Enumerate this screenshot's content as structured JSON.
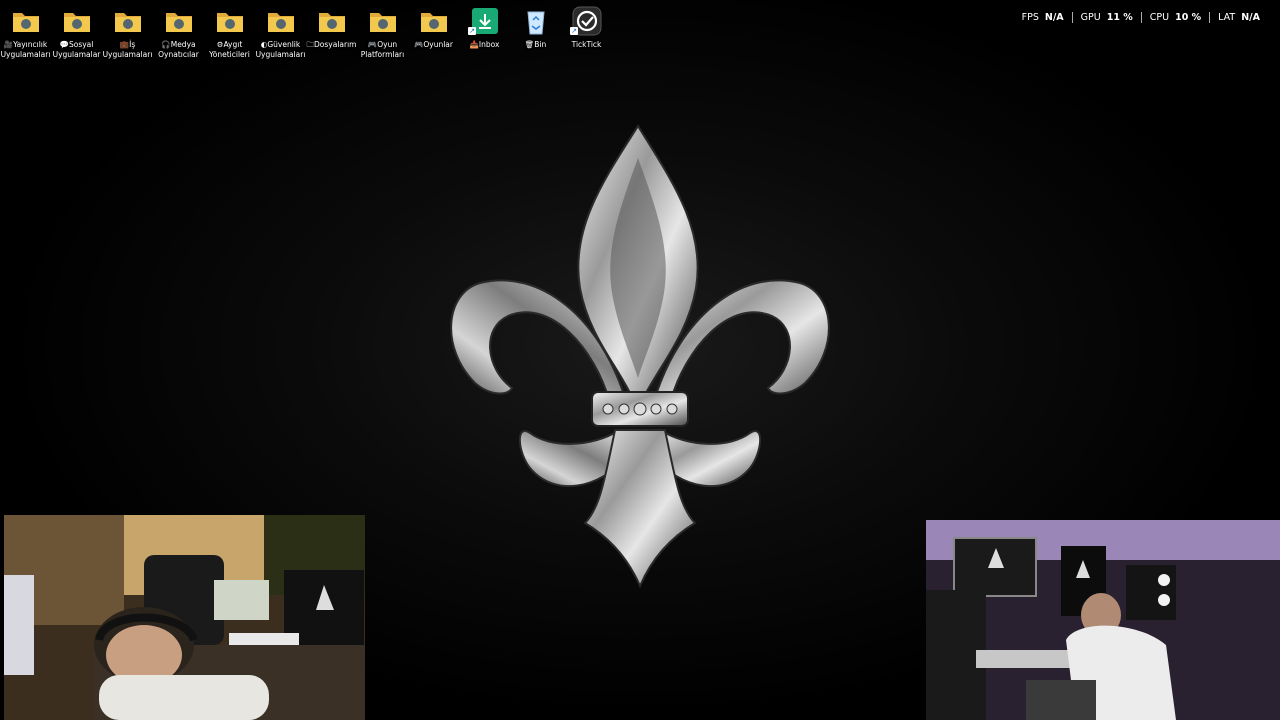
{
  "desktop_icons": [
    {
      "name": "folder-streaming",
      "prefix": "🎥",
      "label": "Yayıncılık\nUygulamaları",
      "color": "#f2c94c",
      "icon": "folder-icon"
    },
    {
      "name": "folder-social",
      "prefix": "💬",
      "label": "Sosyal\nUygulamalar",
      "color": "#f2c94c",
      "icon": "folder-icon"
    },
    {
      "name": "folder-work",
      "prefix": "💼",
      "label": "İş\nUygulamaları",
      "color": "#f2c94c",
      "icon": "folder-icon"
    },
    {
      "name": "folder-media",
      "prefix": "🎧",
      "label": "Medya\nOynatıcılar",
      "color": "#f2c94c",
      "icon": "folder-icon"
    },
    {
      "name": "folder-device",
      "prefix": "⚙",
      "label": "Aygıt\nYöneticileri",
      "color": "#f2c94c",
      "icon": "folder-icon"
    },
    {
      "name": "folder-security",
      "prefix": "◐",
      "label": "Güvenlik\nUygulamaları",
      "color": "#f2c94c",
      "icon": "folder-icon"
    },
    {
      "name": "folder-files",
      "prefix": "🗀",
      "label": "Dosyalarım",
      "color": "#f2c94c",
      "icon": "folder-icon"
    },
    {
      "name": "folder-game-platforms",
      "prefix": "🎮",
      "label": "Oyun\nPlatformları",
      "color": "#f2c94c",
      "icon": "folder-icon"
    },
    {
      "name": "folder-games",
      "prefix": "🎮",
      "label": "Oyunlar",
      "color": "#f2c94c",
      "icon": "folder-icon"
    },
    {
      "name": "inbox-shortcut",
      "prefix": "📥",
      "label": "Inbox",
      "color": "#19a974",
      "icon": "download-icon"
    },
    {
      "name": "recycle-bin",
      "prefix": "🗑",
      "label": "Bin",
      "color": "#cfe8ff",
      "icon": "recycle-bin-icon"
    },
    {
      "name": "ticktick-shortcut",
      "prefix": "",
      "label": "TickTick",
      "color": "#2b2b2b",
      "icon": "ticktick-icon"
    }
  ],
  "perf": [
    {
      "label": "FPS",
      "value": "N/A"
    },
    {
      "label": "GPU",
      "value": "11 %"
    },
    {
      "label": "CPU",
      "value": "10 %"
    },
    {
      "label": "LAT",
      "value": "N/A"
    }
  ]
}
